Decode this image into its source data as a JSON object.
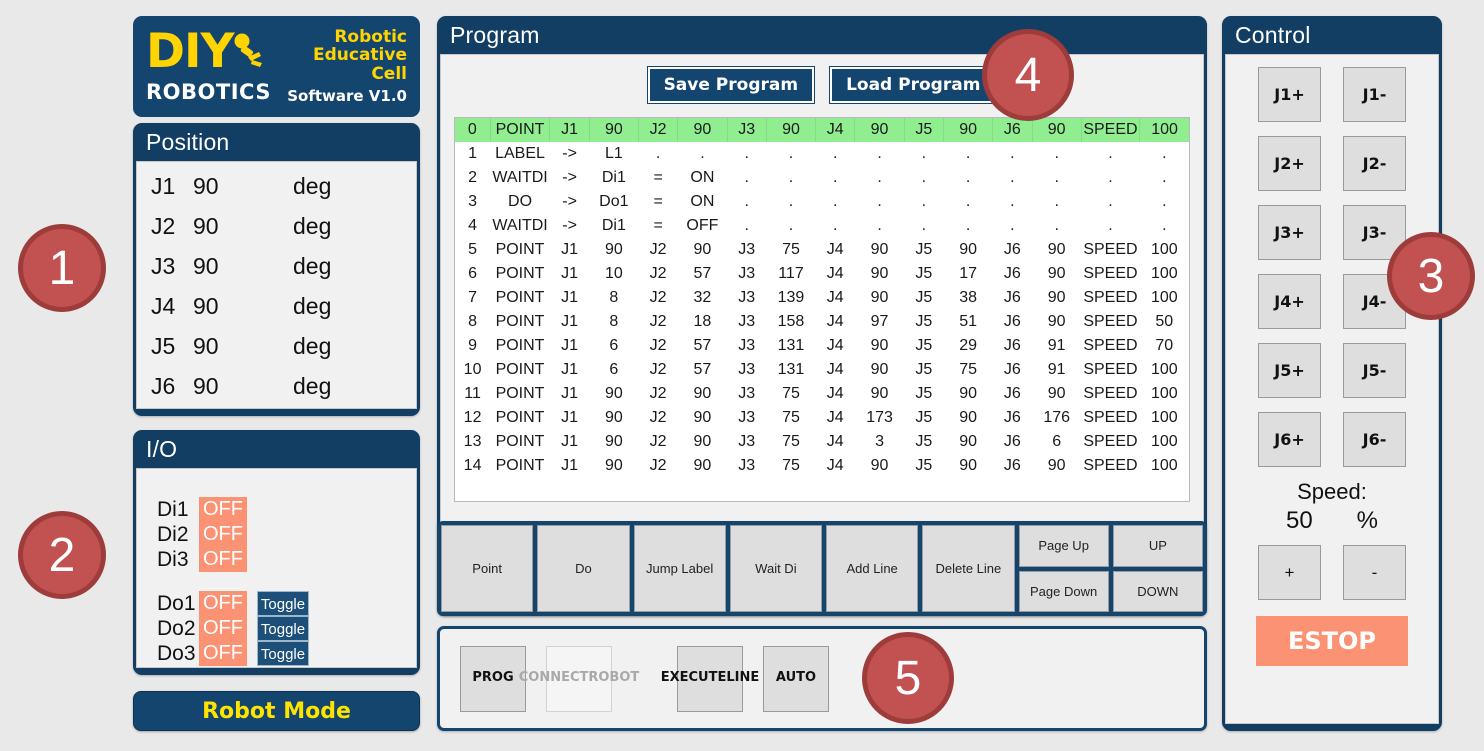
{
  "logo": {
    "brand_main": "DIY",
    "brand_sub": "ROBOTICS",
    "tagline_line1": "Robotic",
    "tagline_line2": "Educative",
    "tagline_line3": "Cell",
    "version": "Software V1.0",
    "accent_yellow": "#ffd400",
    "navy": "#14456e"
  },
  "position": {
    "title": "Position",
    "unit": "deg",
    "joints": [
      {
        "name": "J1",
        "value": "90"
      },
      {
        "name": "J2",
        "value": "90"
      },
      {
        "name": "J3",
        "value": "90"
      },
      {
        "name": "J4",
        "value": "90"
      },
      {
        "name": "J5",
        "value": "90"
      },
      {
        "name": "J6",
        "value": "90"
      }
    ]
  },
  "io": {
    "title": "I/O",
    "inputs": [
      {
        "name": "Di1",
        "state": "OFF"
      },
      {
        "name": "Di2",
        "state": "OFF"
      },
      {
        "name": "Di3",
        "state": "OFF"
      }
    ],
    "outputs": [
      {
        "name": "Do1",
        "state": "OFF",
        "toggle_label": "Toggle"
      },
      {
        "name": "Do2",
        "state": "OFF",
        "toggle_label": "Toggle"
      },
      {
        "name": "Do3",
        "state": "OFF",
        "toggle_label": "Toggle"
      }
    ],
    "off_color": "#fa9273"
  },
  "robot_mode": {
    "label": "Robot Mode"
  },
  "program": {
    "title": "Program",
    "save_label": "Save Program",
    "load_label": "Load Program",
    "highlight_color": "#90ee90",
    "empty_cell": ".",
    "rows": [
      {
        "index": "0",
        "cmd": "POINT",
        "cells": [
          "J1",
          "90",
          "J2",
          "90",
          "J3",
          "90",
          "J4",
          "90",
          "J5",
          "90",
          "J6",
          "90",
          "SPEED",
          "100"
        ],
        "selected": true
      },
      {
        "index": "1",
        "cmd": "LABEL",
        "cells": [
          "->",
          "L1",
          ".",
          ".",
          ".",
          ".",
          ".",
          ".",
          ".",
          ".",
          ".",
          ".",
          ".",
          "."
        ],
        "selected": false
      },
      {
        "index": "2",
        "cmd": "WAITDI",
        "cells": [
          "->",
          "Di1",
          "=",
          "ON",
          ".",
          ".",
          ".",
          ".",
          ".",
          ".",
          ".",
          ".",
          ".",
          "."
        ],
        "selected": false
      },
      {
        "index": "3",
        "cmd": "DO",
        "cells": [
          "->",
          "Do1",
          "=",
          "ON",
          ".",
          ".",
          ".",
          ".",
          ".",
          ".",
          ".",
          ".",
          ".",
          "."
        ],
        "selected": false
      },
      {
        "index": "4",
        "cmd": "WAITDI",
        "cells": [
          "->",
          "Di1",
          "=",
          "OFF",
          ".",
          ".",
          ".",
          ".",
          ".",
          ".",
          ".",
          ".",
          ".",
          "."
        ],
        "selected": false
      },
      {
        "index": "5",
        "cmd": "POINT",
        "cells": [
          "J1",
          "90",
          "J2",
          "90",
          "J3",
          "75",
          "J4",
          "90",
          "J5",
          "90",
          "J6",
          "90",
          "SPEED",
          "100"
        ],
        "selected": false
      },
      {
        "index": "6",
        "cmd": "POINT",
        "cells": [
          "J1",
          "10",
          "J2",
          "57",
          "J3",
          "117",
          "J4",
          "90",
          "J5",
          "17",
          "J6",
          "90",
          "SPEED",
          "100"
        ],
        "selected": false
      },
      {
        "index": "7",
        "cmd": "POINT",
        "cells": [
          "J1",
          "8",
          "J2",
          "32",
          "J3",
          "139",
          "J4",
          "90",
          "J5",
          "38",
          "J6",
          "90",
          "SPEED",
          "100"
        ],
        "selected": false
      },
      {
        "index": "8",
        "cmd": "POINT",
        "cells": [
          "J1",
          "8",
          "J2",
          "18",
          "J3",
          "158",
          "J4",
          "97",
          "J5",
          "51",
          "J6",
          "90",
          "SPEED",
          "50"
        ],
        "selected": false
      },
      {
        "index": "9",
        "cmd": "POINT",
        "cells": [
          "J1",
          "6",
          "J2",
          "57",
          "J3",
          "131",
          "J4",
          "90",
          "J5",
          "29",
          "J6",
          "91",
          "SPEED",
          "70"
        ],
        "selected": false
      },
      {
        "index": "10",
        "cmd": "POINT",
        "cells": [
          "J1",
          "6",
          "J2",
          "57",
          "J3",
          "131",
          "J4",
          "90",
          "J5",
          "75",
          "J6",
          "91",
          "SPEED",
          "100"
        ],
        "selected": false
      },
      {
        "index": "11",
        "cmd": "POINT",
        "cells": [
          "J1",
          "90",
          "J2",
          "90",
          "J3",
          "75",
          "J4",
          "90",
          "J5",
          "90",
          "J6",
          "90",
          "SPEED",
          "100"
        ],
        "selected": false
      },
      {
        "index": "12",
        "cmd": "POINT",
        "cells": [
          "J1",
          "90",
          "J2",
          "90",
          "J3",
          "75",
          "J4",
          "173",
          "J5",
          "90",
          "J6",
          "176",
          "SPEED",
          "100"
        ],
        "selected": false
      },
      {
        "index": "13",
        "cmd": "POINT",
        "cells": [
          "J1",
          "90",
          "J2",
          "90",
          "J3",
          "75",
          "J4",
          "3",
          "J5",
          "90",
          "J6",
          "6",
          "SPEED",
          "100"
        ],
        "selected": false
      },
      {
        "index": "14",
        "cmd": "POINT",
        "cells": [
          "J1",
          "90",
          "J2",
          "90",
          "J3",
          "75",
          "J4",
          "90",
          "J5",
          "90",
          "J6",
          "90",
          "SPEED",
          "100"
        ],
        "selected": false
      }
    ]
  },
  "toolbar": {
    "buttons": [
      "Point",
      "Do",
      "Jump Label",
      "Wait Di",
      "Add Line",
      "Delete Line"
    ],
    "page_up": "Page Up",
    "page_down": "Page Down",
    "up": "UP",
    "down": "DOWN"
  },
  "actions": {
    "prog": "PROG",
    "connect_line1": "CONNECT",
    "connect_line2": "ROBOT",
    "execute_line1": "EXECUTE",
    "execute_line2": "LINE",
    "auto": "AUTO"
  },
  "control": {
    "title": "Control",
    "jog_buttons": [
      "J1+",
      "J1-",
      "J2+",
      "J2-",
      "J3+",
      "J3-",
      "J4+",
      "J4-",
      "J5+",
      "J5-",
      "J6+",
      "J6-"
    ],
    "speed_label": "Speed:",
    "speed_value": "50",
    "speed_unit": "%",
    "plus": "+",
    "minus": "-",
    "estop": "ESTOP",
    "estop_color": "#fa9273"
  },
  "callouts": [
    {
      "number": "1"
    },
    {
      "number": "2"
    },
    {
      "number": "3"
    },
    {
      "number": "4"
    },
    {
      "number": "5"
    }
  ]
}
